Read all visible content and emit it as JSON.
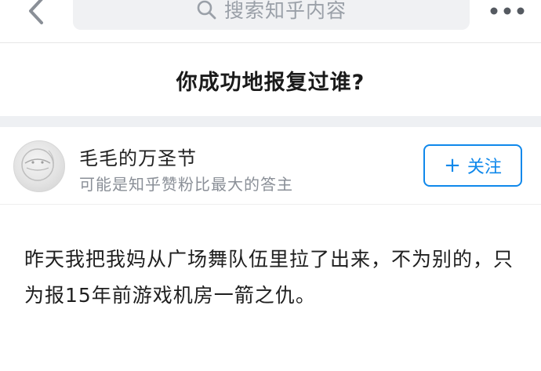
{
  "topbar": {
    "back_icon": "chevron-left-icon",
    "search_icon": "search-icon",
    "search_placeholder": "搜索知乎内容",
    "more_icon": "more-dots-icon"
  },
  "question": {
    "title": "你成功地报复过谁?"
  },
  "author": {
    "name": "毛毛的万圣节",
    "bio": "可能是知乎赞粉比最大的答主",
    "follow_label": "关注",
    "follow_plus": "+"
  },
  "answer": {
    "content": "昨天我把我妈从广场舞队伍里拉了出来，不为别的，只为报15年前游戏机房一箭之仇。"
  },
  "colors": {
    "accent": "#0f88eb",
    "text_primary": "#1a1a1a",
    "text_secondary": "#8a8f97",
    "search_bg": "#f0f1f3",
    "divider_band": "#eef0f3"
  }
}
